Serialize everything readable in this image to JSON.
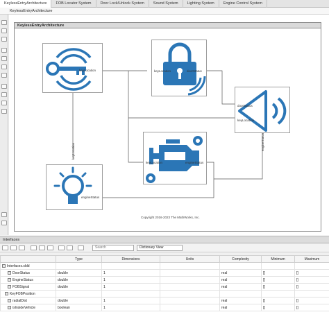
{
  "tabs": [
    "KeylessEntryArchitecture",
    "FOB Locator System",
    "Door Lock/Unlock System",
    "Sound System",
    "Lighting System",
    "Engine Control System"
  ],
  "breadcrumb": "KeylessEntryArchitecture",
  "architecture_title": "KeylessEntryArchitecture",
  "components": {
    "fob": {
      "port_out": "keyLocation"
    },
    "door": {
      "port_in": "keyLocation",
      "port_out": "doorStatus"
    },
    "sound": {
      "port_in1": "doorStatus",
      "port_in2": "keyLocation",
      "port_in3": "engineStatus"
    },
    "engine": {
      "port_in": "keyLocation",
      "port_out": "engineStatus"
    },
    "light": {
      "port_in1": "keyLocation",
      "port_in2": "engineStatus"
    }
  },
  "copyright": "Copyright 2016-2023 The MathWorks, Inc.",
  "interfaces_panel": {
    "title": "Interfaces",
    "search_placeholder": "Search",
    "view": "Dictionary View",
    "columns": [
      "",
      "Type",
      "Dimensions",
      "Units",
      "Complexity",
      "Minimum",
      "Maximum"
    ],
    "rows": [
      {
        "name": "Interfaces.sldd",
        "type": "",
        "dims": "",
        "units": "",
        "complexity": "",
        "min": "",
        "max": ""
      },
      {
        "name": "DoorStatus",
        "type": "double",
        "dims": "1",
        "units": "",
        "complexity": "real",
        "min": "[]",
        "max": "[]"
      },
      {
        "name": "EngineStatus",
        "type": "double",
        "dims": "1",
        "units": "",
        "complexity": "real",
        "min": "[]",
        "max": "[]"
      },
      {
        "name": "FOBSignal",
        "type": "double",
        "dims": "1",
        "units": "",
        "complexity": "real",
        "min": "[]",
        "max": "[]"
      },
      {
        "name": "KeyFOBPosition",
        "type": "",
        "dims": "",
        "units": "",
        "complexity": "",
        "min": "",
        "max": ""
      },
      {
        "name": "radialDist",
        "type": "double",
        "dims": "1",
        "units": "",
        "complexity": "real",
        "min": "[]",
        "max": "[]"
      },
      {
        "name": "isInsideVehicle",
        "type": "boolean",
        "dims": "1",
        "units": "",
        "complexity": "real",
        "min": "[]",
        "max": "[]"
      }
    ]
  },
  "colors": {
    "icon_blue": "#2b76b6",
    "wire": "#555555"
  }
}
